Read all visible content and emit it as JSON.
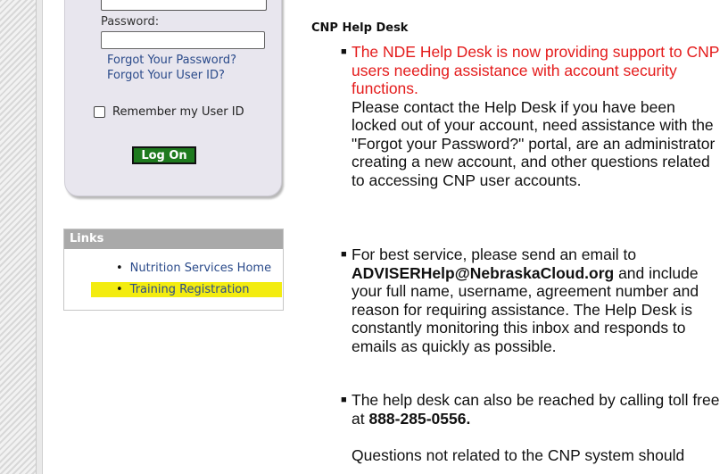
{
  "login": {
    "password_label": "Password:",
    "forgot_password": "Forgot Your Password?",
    "forgot_userid": "Forgot Your User ID?",
    "remember_label": "Remember my User ID",
    "logon_button": "Log On"
  },
  "links": {
    "header": "Links",
    "items": [
      {
        "label": "Nutrition Services Home",
        "highlighted": false
      },
      {
        "label": "Training Registration",
        "highlighted": true
      }
    ]
  },
  "helpdesk": {
    "title": "CNP Help Desk",
    "item1_red": "The NDE Help Desk is now providing support to CNP users needing assistance with account security functions.",
    "item1_body": "Please contact the Help Desk if you have been locked out of your account, need assistance with the \"Forgot your Password?\" portal, are an administrator creating a new account, and other questions related to accessing CNP user accounts.",
    "item2_pre": "For best service, please send an email to ",
    "item2_email": "ADVISERHelp@NebraskaCloud.org",
    "item2_post": " and include your full name, username, agreement number and reason for requiring assistance.  The Help Desk is constantly monitoring this inbox and responds to emails as quickly as possible.",
    "item3_pre": "The help desk can also be reached by calling toll free at ",
    "item3_phone": "888-285-0556.",
    "item4_text": "Questions not related to the CNP system should"
  },
  "colors": {
    "logon_green": "#1e7a1e",
    "highlight_yellow": "#f3ec10",
    "alert_red": "#e41b1b",
    "link_blue": "#2a4a8a"
  }
}
